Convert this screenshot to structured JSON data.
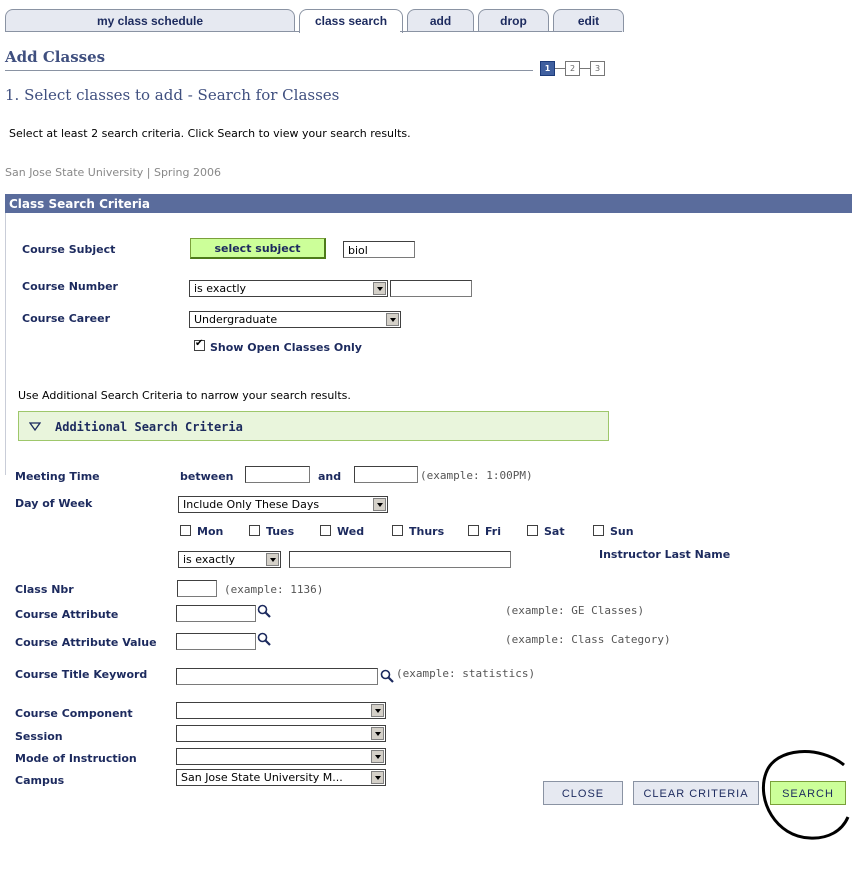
{
  "tabs": [
    {
      "label": "my class schedule"
    },
    {
      "label": "class search"
    },
    {
      "label": "add"
    },
    {
      "label": "drop"
    },
    {
      "label": "edit"
    }
  ],
  "page_title": "Add Classes",
  "steps": [
    "1",
    "2",
    "3"
  ],
  "section_title": "1. Select classes to add - Search for Classes",
  "instruction": "Select at least 2 search criteria. Click Search to view your search results.",
  "institution_term": "San Jose State University | Spring 2006",
  "criteria_header": "Class Search Criteria",
  "course_subject": {
    "label": "Course Subject",
    "button": "select subject",
    "value": "biol"
  },
  "course_number": {
    "label": "Course Number",
    "operator": "is exactly",
    "value": ""
  },
  "course_career": {
    "label": "Course Career",
    "value": "Undergraduate"
  },
  "open_only": {
    "label": "Show Open Classes Only",
    "checked": true
  },
  "additional_hint": "Use Additional Search Criteria to narrow your search results.",
  "additional_header": "Additional Search Criteria",
  "meeting_time": {
    "label": "Meeting Time",
    "between": "between",
    "and": "and",
    "example": "(example: 1:00PM)"
  },
  "day_of_week": {
    "label": "Day of Week",
    "value": "Include Only These Days",
    "days": [
      "Mon",
      "Tues",
      "Wed",
      "Thurs",
      "Fri",
      "Sat",
      "Sun"
    ]
  },
  "instructor": {
    "operator": "is exactly",
    "value": "",
    "label": "Instructor Last Name"
  },
  "class_nbr": {
    "label": "Class Nbr",
    "example": "(example: 1136)"
  },
  "course_attribute": {
    "label": "Course Attribute",
    "example": "(example: GE Classes)"
  },
  "course_attribute_value": {
    "label": "Course Attribute Value",
    "example": "(example: Class Category)"
  },
  "course_title_keyword": {
    "label": "Course Title Keyword",
    "example": "(example: statistics)"
  },
  "course_component": {
    "label": "Course Component",
    "value": ""
  },
  "session": {
    "label": "Session",
    "value": ""
  },
  "mode": {
    "label": "Mode of Instruction",
    "value": ""
  },
  "campus": {
    "label": "Campus",
    "value": "San Jose State University M..."
  },
  "buttons": {
    "close": "CLOSE",
    "clear": "CLEAR CRITERIA",
    "search": "SEARCH"
  },
  "colors": {
    "header_bar": "#5a6c9c",
    "link_navy": "#1c2a5e",
    "select_green": "#ccff99",
    "additional_bg": "#e9f5dc"
  }
}
